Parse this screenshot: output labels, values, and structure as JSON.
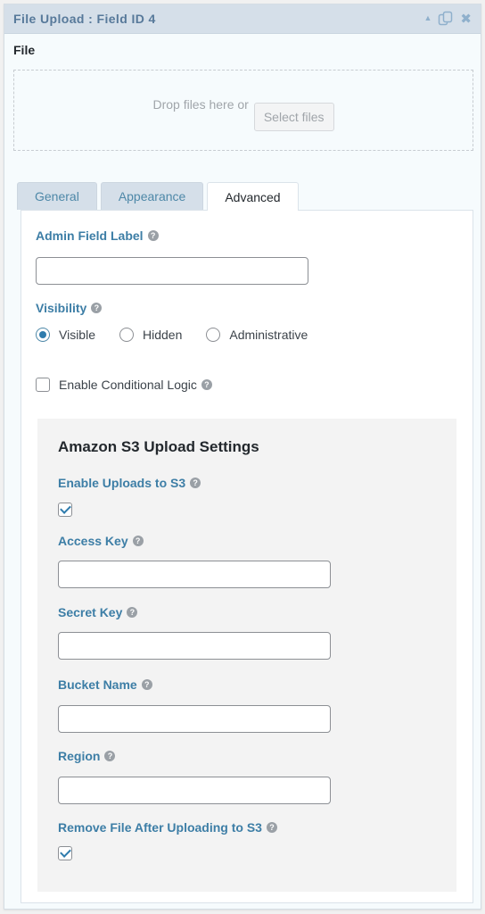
{
  "panel": {
    "title": "File Upload : Field ID 4",
    "header_icons": {
      "collapse": "▲",
      "duplicate": "⎘",
      "close": "✖"
    }
  },
  "file_field": {
    "label": "File",
    "drop_text": "Drop files here or",
    "select_button": "Select files"
  },
  "tabs": [
    {
      "label": "General",
      "active": false
    },
    {
      "label": "Appearance",
      "active": false
    },
    {
      "label": "Advanced",
      "active": true
    }
  ],
  "advanced": {
    "admin_field_label": {
      "label": "Admin Field Label",
      "value": "",
      "help": "?"
    },
    "visibility": {
      "label": "Visibility",
      "help": "?",
      "options": [
        {
          "label": "Visible",
          "checked": true
        },
        {
          "label": "Hidden",
          "checked": false
        },
        {
          "label": "Administrative",
          "checked": false
        }
      ]
    },
    "conditional_logic": {
      "label": "Enable Conditional Logic",
      "checked": false,
      "help": "?"
    },
    "s3": {
      "title": "Amazon S3 Upload Settings",
      "enable_uploads": {
        "label": "Enable Uploads to S3",
        "checked": true,
        "help": "?"
      },
      "access_key": {
        "label": "Access Key",
        "value": "",
        "help": "?"
      },
      "secret_key": {
        "label": "Secret Key",
        "value": "",
        "help": "?"
      },
      "bucket_name": {
        "label": "Bucket Name",
        "value": "",
        "help": "?"
      },
      "region": {
        "label": "Region",
        "value": "",
        "help": "?"
      },
      "remove_after_upload": {
        "label": "Remove File After Uploading to S3",
        "checked": true,
        "help": "?"
      }
    }
  },
  "colors": {
    "header_bg": "#d5dfe9",
    "title_color": "#57799a",
    "label_color": "#3d7ea6",
    "accent": "#2f7cad",
    "s3_bg": "#f3f3f3"
  }
}
